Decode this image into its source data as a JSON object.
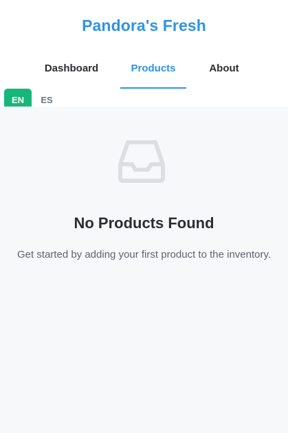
{
  "app": {
    "brand": "Pandora's Fresh"
  },
  "nav": {
    "tabs": [
      {
        "label": "Dashboard",
        "active": false
      },
      {
        "label": "Products",
        "active": true
      },
      {
        "label": "About",
        "active": false
      }
    ]
  },
  "language": {
    "options": [
      {
        "label": "EN",
        "selected": true
      },
      {
        "label": "ES",
        "selected": false
      }
    ]
  },
  "empty_state": {
    "icon": "inbox-icon",
    "title": "No Products Found",
    "description": "Get started by adding your first product to the inventory."
  },
  "colors": {
    "brand": "#2f93e6",
    "active_tab": "#2f93e6",
    "lang_selected_bg": "#17b67a",
    "content_bg": "#f7f8fa",
    "icon": "#dcdee1"
  }
}
